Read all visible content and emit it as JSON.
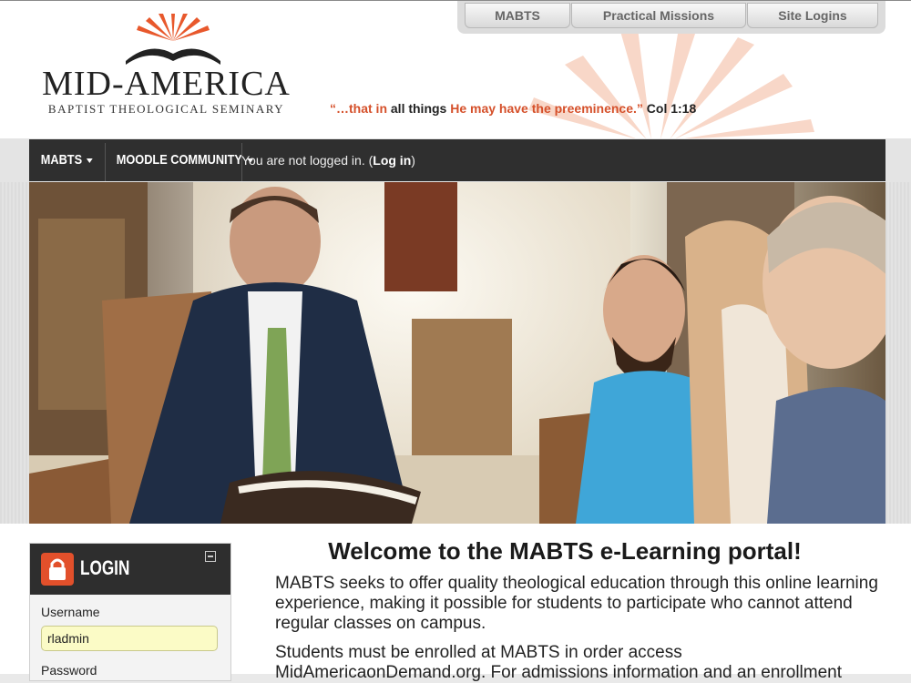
{
  "header": {
    "logo": {
      "main": "MID-AMERICA",
      "sub": "BAPTIST THEOLOGICAL SEMINARY"
    },
    "tagline": {
      "quote_start": "“…that in",
      "quote_mid": "all things",
      "quote_end": "He may have the preeminence.”",
      "reference": "Col 1:18"
    },
    "top_links": [
      "MABTS",
      "Practical Missions",
      "Site Logins"
    ]
  },
  "navbar": {
    "items": [
      {
        "label": "MABTS"
      },
      {
        "label": "MOODLE COMMUNITY"
      }
    ],
    "status_prefix": "You are not logged in. (",
    "status_link": "Log in",
    "status_suffix": ")"
  },
  "login_block": {
    "title": "LOGIN",
    "username_label": "Username",
    "username_value": "rladmin",
    "password_label": "Password"
  },
  "main": {
    "welcome_title": "Welcome to the MABTS e-Learning portal!",
    "intro": "MABTS seeks to offer quality theological education through this online learning experience, making it possible for students to participate who cannot attend regular classes on campus.",
    "enrollment": "Students must be enrolled at MABTS in order access MidAmericaonDemand.org. For admissions information and an enrollment"
  },
  "colors": {
    "accent": "#d5502a",
    "navbar": "#2f2f2f",
    "input_bg": "#fbfbc6"
  },
  "icons": [
    "sunburst-icon",
    "open-book-icon",
    "caret-down-icon",
    "lock-icon",
    "collapse-icon"
  ]
}
